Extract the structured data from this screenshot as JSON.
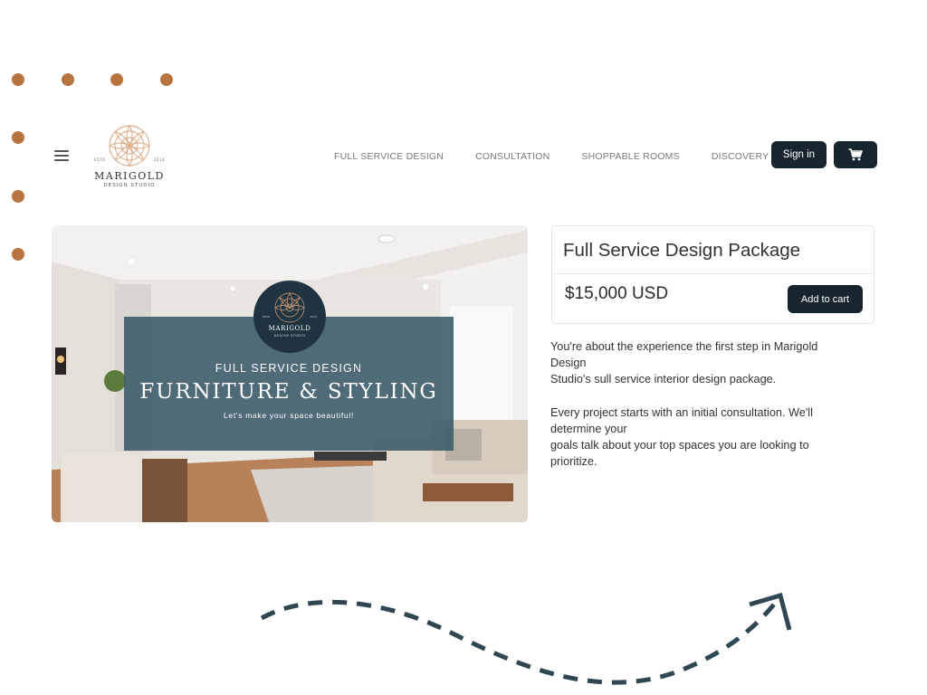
{
  "colors": {
    "accent_dots": "#b8743f",
    "dark_button": "#17252e",
    "overlay": "#395a68",
    "arrow": "#2f4752"
  },
  "logo": {
    "estd": "ESTD",
    "year": "2014",
    "name": "MARIGOLD",
    "subtitle": "DESIGN STUDIO",
    "icon": "mandala-flower-icon"
  },
  "nav": {
    "menu_icon": "hamburger-menu-icon",
    "items": [
      "FULL SERVICE DESIGN",
      "CONSULTATION",
      "SHOPPABLE ROOMS",
      "DISCOVERY CALL"
    ],
    "sign_in_label": "Sign in",
    "cart_icon": "shopping-cart-icon"
  },
  "hero": {
    "badge": {
      "estd": "ESTD",
      "year": "2014",
      "name": "MARIGOLD",
      "subtitle": "DESIGN STUDIO"
    },
    "kicker": "FULL SERVICE DESIGN",
    "headline": "FURNITURE & STYLING",
    "tagline": "Let's make your space beautiful!"
  },
  "product": {
    "title": "Full Service Design Package",
    "price": "$15,000 USD",
    "add_to_cart_label": "Add to cart"
  },
  "description": {
    "para1": [
      "You're about the experience the first step in Marigold",
      "Design",
      "Studio's sull service interior design package."
    ],
    "para2": [
      "Every project starts with an initial consultation. We'll",
      "determine your",
      "goals talk about your top spaces you are looking to",
      "prioritize."
    ]
  }
}
